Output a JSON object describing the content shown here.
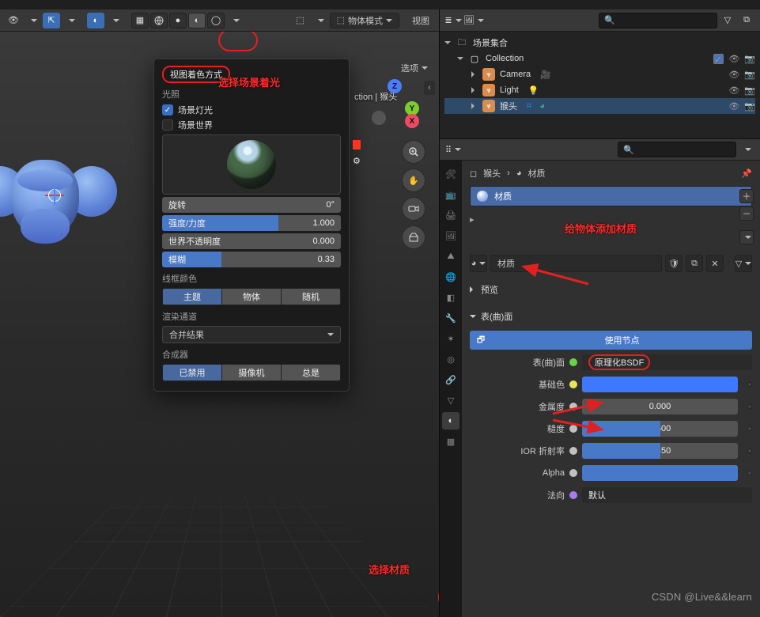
{
  "header_left": {
    "mode_label": "物体模式",
    "menu_view": "视图",
    "options": "选项"
  },
  "status_label": "ction | 猴头",
  "popup": {
    "title": "视图着色方式",
    "section_light": "光照",
    "chk_scene_light": "场景灯光",
    "chk_scene_world": "场景世界",
    "sliders": {
      "rotate": {
        "label": "旋转",
        "value": "0°",
        "fill": 0
      },
      "intensity": {
        "label": "强度/力度",
        "value": "1.000",
        "fill": 65
      },
      "world_opacity": {
        "label": "世界不透明度",
        "value": "0.000",
        "fill": 0
      },
      "blur": {
        "label": "模糊",
        "value": "0.33",
        "fill": 33
      }
    },
    "section_wire": "线框颜色",
    "wire_btns": [
      "主题",
      "物体",
      "随机"
    ],
    "section_render": "渲染通道",
    "render_pass": "合并结果",
    "section_comp": "合成器",
    "comp_btns": [
      "已禁用",
      "摄像机",
      "总是"
    ]
  },
  "annotations": {
    "a1": "选择场景着光",
    "a2": "选择材质",
    "a3": "给物体添加材质"
  },
  "outliner": {
    "root": "场景集合",
    "collection": "Collection",
    "items": [
      {
        "name": "Camera",
        "color": "#db8b4a"
      },
      {
        "name": "Light",
        "color": "#db8b4a"
      },
      {
        "name": "猴头",
        "color": "#db8b4a"
      }
    ]
  },
  "properties": {
    "crumb_obj": "猴头",
    "crumb_mat": "材质",
    "slot_name": "材质",
    "mat_name": "材质",
    "panel_preview": "预览",
    "panel_surface": "表(曲)面",
    "use_nodes": "使用节点",
    "surface_label": "表(曲)面",
    "shader": "原理化BSDF",
    "rows": {
      "base": {
        "label": "基础色",
        "color": "#3d78ff"
      },
      "metal": {
        "label": "金属度",
        "value": "0.000",
        "fill": 0
      },
      "rough": {
        "label": "糙度",
        "value": "0.500",
        "fill": 50
      },
      "ior": {
        "label": "IOR 折射率",
        "value": "1.450",
        "fill": 50
      },
      "alpha": {
        "label": "Alpha",
        "value": "1.000",
        "fill": 100
      },
      "normal": {
        "label": "法向",
        "value": "默认"
      }
    }
  },
  "watermark": "CSDN @Live&&learn"
}
